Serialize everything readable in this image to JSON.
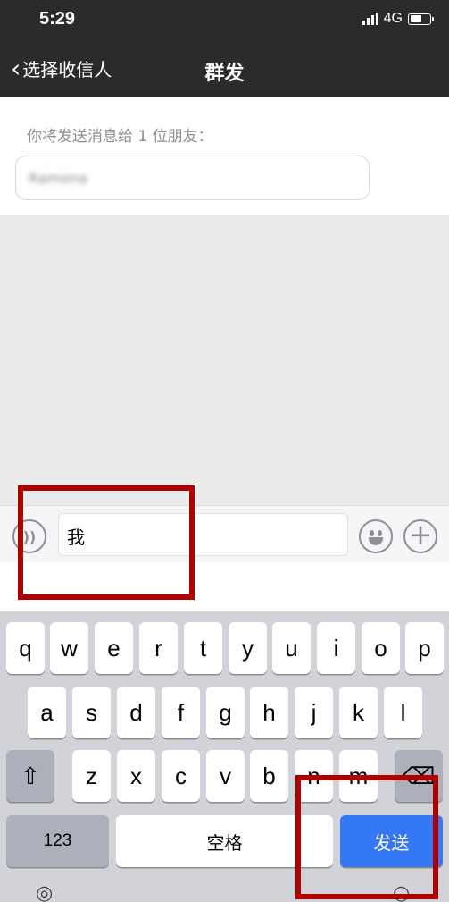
{
  "status": {
    "time": "5:29",
    "network": "4G"
  },
  "nav": {
    "back_label": "选择收信人",
    "title": "群发"
  },
  "recipient": {
    "hint": "你将发送消息给 1 位朋友：",
    "name": "Ramona"
  },
  "input": {
    "text": "我"
  },
  "keyboard": {
    "row1": [
      "q",
      "w",
      "e",
      "r",
      "t",
      "y",
      "u",
      "i",
      "o",
      "p"
    ],
    "row2": [
      "a",
      "s",
      "d",
      "f",
      "g",
      "h",
      "j",
      "k",
      "l"
    ],
    "row3": [
      "z",
      "x",
      "c",
      "v",
      "b",
      "n",
      "m"
    ],
    "num_label": "123",
    "space_label": "空格",
    "send_label": "发送"
  },
  "colors": {
    "bar": "#2b2b2d",
    "send": "#3478f6",
    "highlight": "#b00000",
    "keyboard": "#d1d3d9"
  }
}
